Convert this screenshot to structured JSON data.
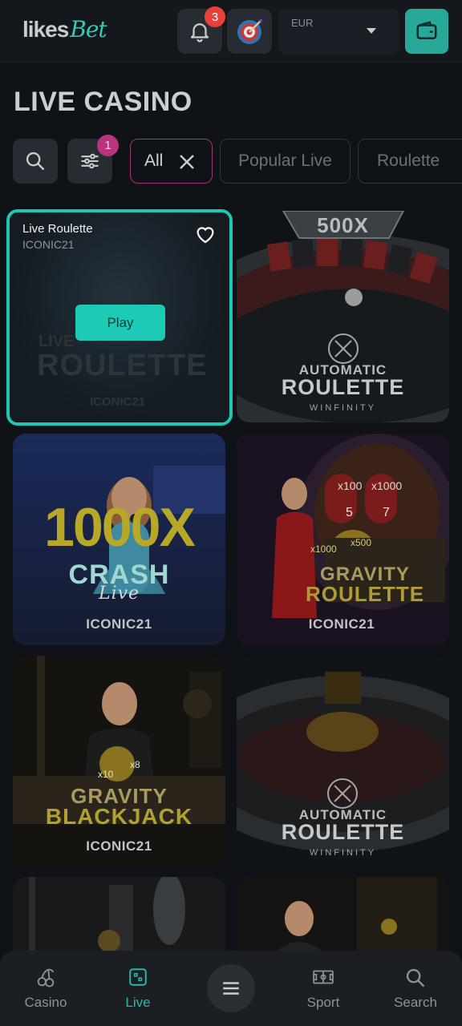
{
  "header": {
    "logo_main": "likes",
    "logo_accent": "Bet",
    "notification_count": "3",
    "currency": "EUR"
  },
  "page_title": "LIVE CASINO",
  "filters": {
    "active_count": "1",
    "chips": [
      {
        "label": "All",
        "active": true
      },
      {
        "label": "Popular Live",
        "active": false
      },
      {
        "label": "Roulette",
        "active": false
      }
    ]
  },
  "games": [
    {
      "name": "Live Roulette",
      "provider": "ICONIC21",
      "play_label": "Play",
      "art_title_1": "LIVE",
      "art_title_2": "ROULETTE",
      "art_brand": "ICONIC21"
    },
    {
      "art_badge": "500X",
      "art_title_1": "AUTOMATIC",
      "art_title_2": "ROULETTE",
      "art_brand": "WINFINITY"
    },
    {
      "art_title_1": "1000X",
      "art_title_2": "CRASH",
      "art_title_3": "Live",
      "art_brand": "ICONIC21"
    },
    {
      "art_title_1": "GRAVITY",
      "art_title_2": "ROULETTE",
      "art_brand": "ICONIC21",
      "art_mult_1": "x100",
      "art_mult_2": "x1000",
      "art_mult_3": "x1000",
      "art_mult_4": "x500",
      "art_num_1": "5",
      "art_num_2": "7"
    },
    {
      "art_title_1": "GRAVITY",
      "art_title_2": "BLACKJACK",
      "art_brand": "ICONIC21",
      "art_mult_1": "x10",
      "art_mult_2": "x8"
    },
    {
      "art_title_1": "AUTOMATIC",
      "art_title_2": "ROULETTE",
      "art_brand": "WINFINITY"
    }
  ],
  "bottom_nav": [
    {
      "label": "Casino",
      "icon": "cherries-icon"
    },
    {
      "label": "Live",
      "icon": "live-dice-icon",
      "active": true
    },
    {
      "label": "",
      "icon": "menu-icon"
    },
    {
      "label": "Sport",
      "icon": "soccer-field-icon"
    },
    {
      "label": "Search",
      "icon": "search-icon"
    }
  ],
  "colors": {
    "accent_teal": "#1fc7b5",
    "badge_red": "#e8413c",
    "filter_badge": "#b9347f",
    "background": "#0f1317"
  }
}
